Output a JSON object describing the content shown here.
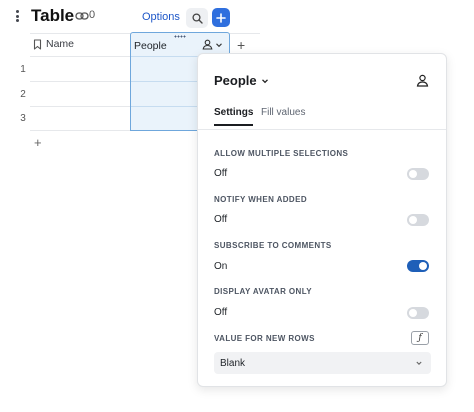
{
  "header": {
    "title": "Table",
    "link_count": "0",
    "options_label": "Options"
  },
  "table": {
    "columns": [
      "Name",
      "People"
    ],
    "row_numbers": [
      "1",
      "2",
      "3"
    ],
    "add_column_label": "+",
    "add_row_label": "+"
  },
  "popover": {
    "title": "People",
    "tabs": [
      "Settings",
      "Fill values"
    ],
    "active_tab": "Settings",
    "settings": [
      {
        "label": "ALLOW MULTIPLE SELECTIONS",
        "value": "Off",
        "on": false
      },
      {
        "label": "NOTIFY WHEN ADDED",
        "value": "Off",
        "on": false
      },
      {
        "label": "SUBSCRIBE TO COMMENTS",
        "value": "On",
        "on": true
      },
      {
        "label": "DISPLAY AVATAR ONLY",
        "value": "Off",
        "on": false
      }
    ],
    "new_rows": {
      "label": "VALUE FOR NEW ROWS",
      "formula_icon": "ƒ",
      "value": "Blank"
    }
  },
  "colors": {
    "accent": "#2f6fde",
    "link": "#1e57c8",
    "column_highlight": "#eaf3fb",
    "toggle_on": "#1e5fb8",
    "toggle_off": "#d6d9de"
  },
  "icons": [
    "kebab-menu-icon",
    "link-icon",
    "search-icon",
    "plus-icon",
    "bookmark-icon",
    "person-icon",
    "chevron-down-icon",
    "formula-icon"
  ]
}
